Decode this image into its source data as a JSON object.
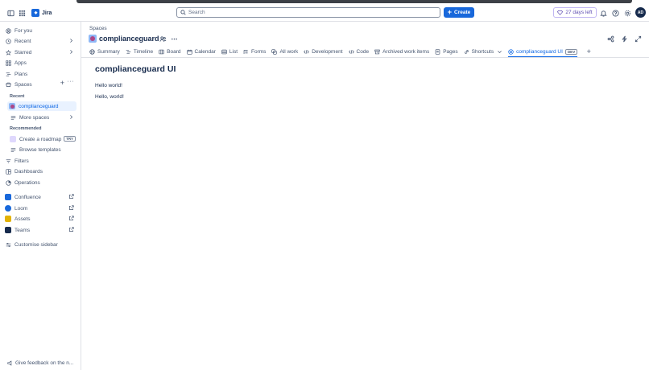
{
  "app": {
    "name": "Jira"
  },
  "search": {
    "placeholder": "Search"
  },
  "create": {
    "label": "Create"
  },
  "trial": {
    "label": "27 days left"
  },
  "user": {
    "initials": "AD"
  },
  "sidebar": {
    "items": [
      {
        "label": "For you",
        "icon": "user-circle-icon"
      },
      {
        "label": "Recent",
        "icon": "clock-icon"
      },
      {
        "label": "Starred",
        "icon": "star-icon"
      },
      {
        "label": "Apps",
        "icon": "apps-icon"
      },
      {
        "label": "Plans",
        "icon": "plans-icon"
      },
      {
        "label": "Spaces",
        "icon": "spaces-icon"
      }
    ],
    "recent_section": "Recent",
    "recent_space": "complianceguard",
    "more_spaces": "More spaces",
    "recommended_section": "Recommended",
    "create_roadmap": "Create a roadmap",
    "try_badge": "TRY",
    "browse_templates": "Browse templates",
    "lower_items": [
      {
        "label": "Filters"
      },
      {
        "label": "Dashboards"
      },
      {
        "label": "Operations"
      }
    ],
    "apps": [
      {
        "label": "Confluence",
        "color": "#1868db"
      },
      {
        "label": "Loom",
        "color": "#1868db"
      },
      {
        "label": "Assets",
        "color": "#e2b203"
      },
      {
        "label": "Teams",
        "color": "#172b4d"
      }
    ],
    "customise": "Customise sidebar",
    "feedback": "Give feedback on the n..."
  },
  "header": {
    "breadcrumb": "Spaces",
    "project_name": "complianceguard"
  },
  "tabs": [
    {
      "label": "Summary",
      "icon": "globe-icon"
    },
    {
      "label": "Timeline",
      "icon": "timeline-icon"
    },
    {
      "label": "Board",
      "icon": "board-icon"
    },
    {
      "label": "Calendar",
      "icon": "calendar-icon"
    },
    {
      "label": "List",
      "icon": "list-icon"
    },
    {
      "label": "Forms",
      "icon": "forms-icon"
    },
    {
      "label": "All work",
      "icon": "all-work-icon"
    },
    {
      "label": "Development",
      "icon": "development-icon"
    },
    {
      "label": "Code",
      "icon": "code-icon"
    },
    {
      "label": "Archived work items",
      "icon": "archive-icon"
    },
    {
      "label": "Pages",
      "icon": "pages-icon"
    },
    {
      "label": "Shortcuts",
      "icon": "link-icon"
    },
    {
      "label": "complianceguard UI",
      "icon": "app-icon",
      "active": true,
      "badge": "DEV"
    }
  ],
  "content": {
    "title": "complianceguard UI",
    "lines": [
      "Hello world!",
      "Hello, world!"
    ]
  },
  "colors": {
    "accent": "#1868db",
    "active_tab": "#0c66e4",
    "trial": "#5e4db2"
  }
}
